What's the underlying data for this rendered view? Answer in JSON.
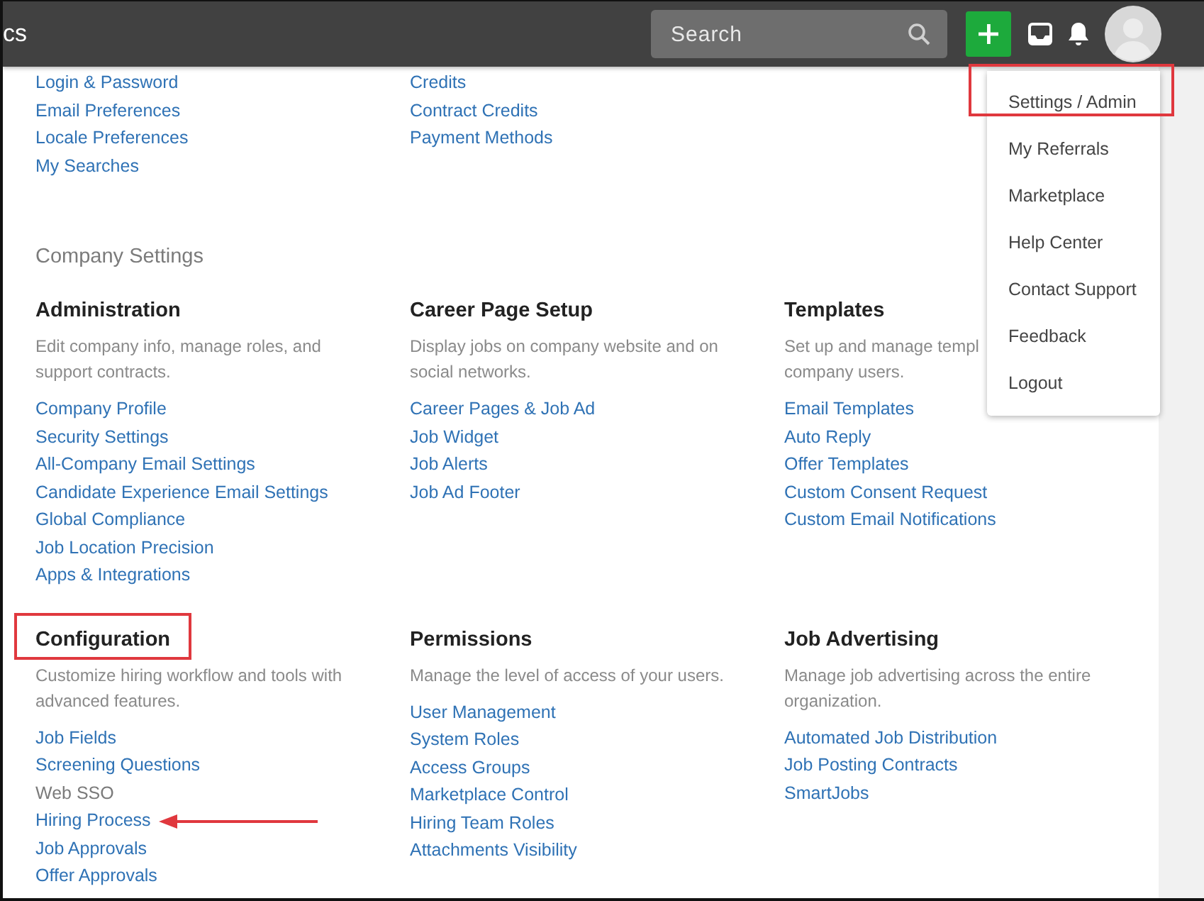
{
  "app_title": "cs",
  "search": {
    "placeholder": "Search"
  },
  "account_columns": [
    {
      "links": [
        "Login & Password",
        "Email Preferences",
        "Locale Preferences",
        "My Searches"
      ]
    },
    {
      "links": [
        "Credits",
        "Contract Credits",
        "Payment Methods"
      ]
    }
  ],
  "company_settings": {
    "title": "Company Settings",
    "groups": [
      {
        "title": "Administration",
        "highlighted": false,
        "description": [
          "Edit company info, manage roles, and",
          "support contracts."
        ],
        "links": [
          {
            "label": "Company Profile",
            "disabled": false,
            "arrow": false
          },
          {
            "label": "Security Settings",
            "disabled": false,
            "arrow": false
          },
          {
            "label": "All-Company Email Settings",
            "disabled": false,
            "arrow": false
          },
          {
            "label": "Candidate Experience Email Settings",
            "disabled": false,
            "arrow": false
          },
          {
            "label": "Global Compliance",
            "disabled": false,
            "arrow": false
          },
          {
            "label": "Job Location Precision",
            "disabled": false,
            "arrow": false
          },
          {
            "label": "Apps & Integrations",
            "disabled": false,
            "arrow": false
          }
        ]
      },
      {
        "title": "Career Page Setup",
        "highlighted": false,
        "description": [
          "Display jobs on company website and on",
          "social networks."
        ],
        "links": [
          {
            "label": "Career Pages & Job Ad",
            "disabled": false,
            "arrow": false
          },
          {
            "label": "Job Widget",
            "disabled": false,
            "arrow": false
          },
          {
            "label": "Job Alerts",
            "disabled": false,
            "arrow": false
          },
          {
            "label": "Job Ad Footer",
            "disabled": false,
            "arrow": false
          }
        ]
      },
      {
        "title": "Templates",
        "highlighted": false,
        "description": [
          "Set up and manage templ",
          "company users."
        ],
        "links": [
          {
            "label": "Email Templates",
            "disabled": false,
            "arrow": false
          },
          {
            "label": "Auto Reply",
            "disabled": false,
            "arrow": false
          },
          {
            "label": "Offer Templates",
            "disabled": false,
            "arrow": false
          },
          {
            "label": "Custom Consent Request",
            "disabled": false,
            "arrow": false
          },
          {
            "label": "Custom Email Notifications",
            "disabled": false,
            "arrow": false
          }
        ]
      },
      {
        "title": "Configuration",
        "highlighted": true,
        "description": [
          "Customize hiring workflow and tools with",
          "advanced features."
        ],
        "links": [
          {
            "label": "Job Fields",
            "disabled": false,
            "arrow": false
          },
          {
            "label": "Screening Questions",
            "disabled": false,
            "arrow": false
          },
          {
            "label": "Web SSO",
            "disabled": true,
            "arrow": false
          },
          {
            "label": "Hiring Process",
            "disabled": false,
            "arrow": true
          },
          {
            "label": "Job Approvals",
            "disabled": false,
            "arrow": false
          },
          {
            "label": "Offer Approvals",
            "disabled": false,
            "arrow": false
          }
        ]
      },
      {
        "title": "Permissions",
        "highlighted": false,
        "description": [
          "Manage the level of access of your users."
        ],
        "links": [
          {
            "label": "User Management",
            "disabled": false,
            "arrow": false
          },
          {
            "label": "System Roles",
            "disabled": false,
            "arrow": false
          },
          {
            "label": "Access Groups",
            "disabled": false,
            "arrow": false
          },
          {
            "label": "Marketplace Control",
            "disabled": false,
            "arrow": false
          },
          {
            "label": "Hiring Team Roles",
            "disabled": false,
            "arrow": false
          },
          {
            "label": "Attachments Visibility",
            "disabled": false,
            "arrow": false
          }
        ]
      },
      {
        "title": "Job Advertising",
        "highlighted": false,
        "description": [
          "Manage job advertising across the entire",
          "organization."
        ],
        "links": [
          {
            "label": "Automated Job Distribution",
            "disabled": false,
            "arrow": false
          },
          {
            "label": "Job Posting Contracts",
            "disabled": false,
            "arrow": false
          },
          {
            "label": "SmartJobs",
            "disabled": false,
            "arrow": false
          }
        ]
      }
    ]
  },
  "user_menu": {
    "items": [
      {
        "label": "Settings / Admin",
        "highlighted": true
      },
      {
        "label": "My Referrals",
        "highlighted": false
      },
      {
        "label": "Marketplace",
        "highlighted": false
      },
      {
        "label": "Help Center",
        "highlighted": false
      },
      {
        "label": "Contact Support",
        "highlighted": false
      },
      {
        "label": "Feedback",
        "highlighted": false
      },
      {
        "label": "Logout",
        "highlighted": false
      }
    ]
  }
}
